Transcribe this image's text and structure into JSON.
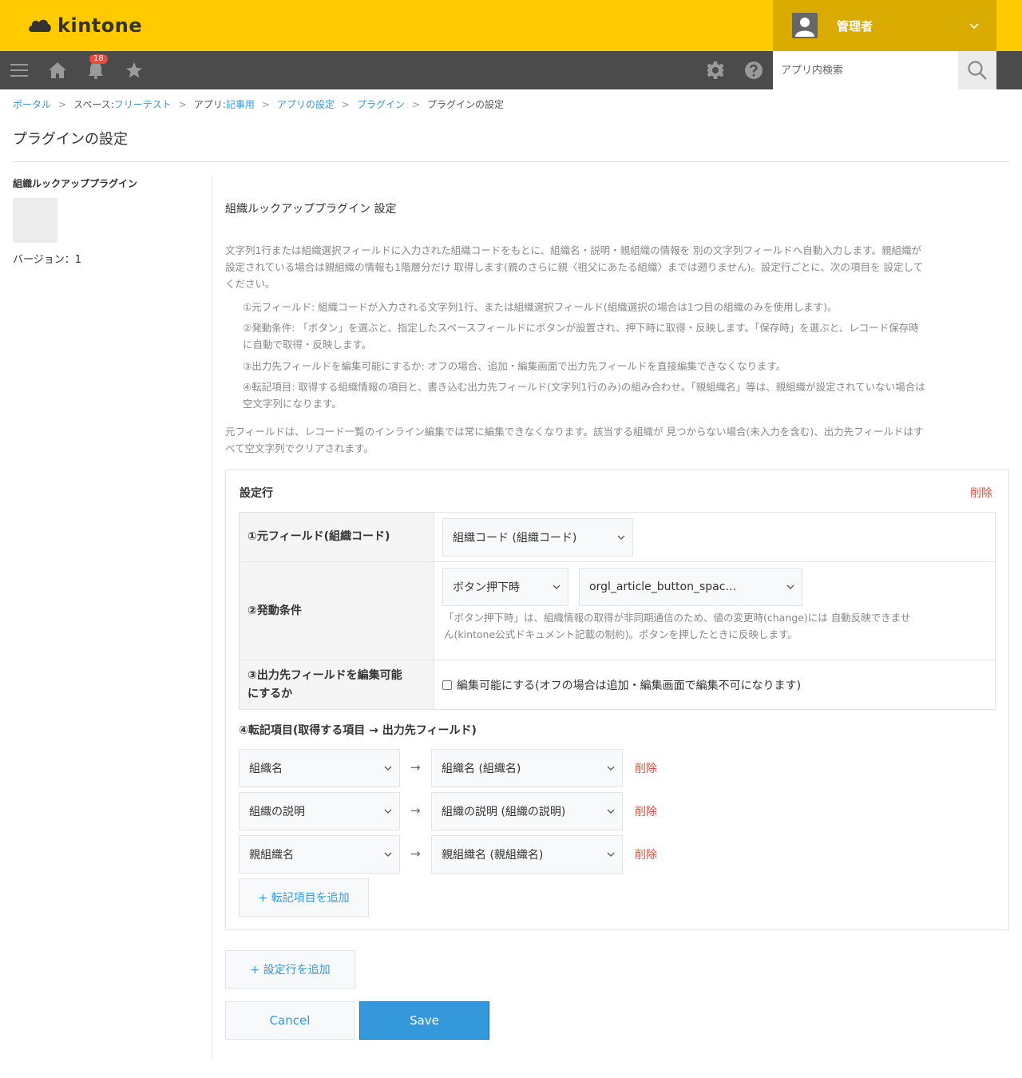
{
  "header": {
    "logo_text": "kintone",
    "user_name": "管理者",
    "brand_color": "#ffcb00",
    "user_area_color": "#d9ab00"
  },
  "navbar": {
    "notification_count": "18",
    "search_placeholder": "アプリ内検索",
    "icons": [
      "menu-icon",
      "home-icon",
      "bell-icon",
      "star-icon",
      "gear-icon",
      "help-icon",
      "search-icon"
    ]
  },
  "breadcrumb": {
    "portal": "ポータル",
    "space_prefix": "スペース: ",
    "space": "フリーテスト",
    "app_prefix": "アプリ: ",
    "app": "記事用",
    "app_settings": "アプリの設定",
    "plugins": "プラグイン",
    "current": "プラグインの設定",
    "separator": ">"
  },
  "page_title": "プラグインの設定",
  "plugin": {
    "name": "組織ルックアッププラグイン",
    "version": "バージョン：1"
  },
  "settings": {
    "title": "組織ルックアッププラグイン 設定",
    "description_lines": [
      "文字列1行または組織選択フィールドに入力された組織コードをもとに、組織名・説明・親組織の情報を 別の文字列フィールドへ自動入力します。親組織が",
      "設定されている場合は親組織の情報も1階層分だけ 取得します(親のさらに親〈祖父にあたる組織〉までは遡りません)。設定行ごとに、次の項目を 設定して",
      "ください。"
    ],
    "items": [
      [
        "①元フィールド: 組織コードが入力される文字列1行、または組織選択フィールド(組織選択の場合は1つ目の組織のみを使用します)。"
      ],
      [
        "②発動条件: 「ボタン」を選ぶと、指定したスペースフィールドにボタンが設置され、押下時に取得・反映します。「保存時」を選ぶと、レコード保存時",
        "に自動で取得・反映します。"
      ],
      [
        "③出力先フィールドを編集可能にするか: オフの場合、追加・編集画面で出力先フィールドを直接編集できなくなります。"
      ],
      [
        "④転記項目: 取得する組織情報の項目と、書き込む出力先フィールド(文字列1行のみ)の組み合わせ。「親組織名」等は、親組織が設定されていない場合は",
        "空文字列になります。"
      ]
    ],
    "footer_lines": [
      "元フィールドは、レコード一覧のインライン編集では常に編集できなくなります。該当する組織が 見つからない場合(未入力を含む)、出力先フィールドはす",
      "べて空文字列でクリアされます。"
    ]
  },
  "config_row": {
    "title": "設定行",
    "delete_label": "削除",
    "source_field_label": "①元フィールド(組織コード)",
    "source_field_value": "組織コード (組織コード)",
    "trigger_label": "②発動条件",
    "trigger_value": "ボタン押下時",
    "space_field_value": "orgl_article_button_spac…",
    "trigger_note_lines": [
      "「ボタン押下時」は、組織情報の取得が非同期通信のため、値の変更時(change)には 自動反映できませ",
      "ん(kintone公式ドキュメント記載の制約)。ボタンを押したときに反映します。"
    ],
    "editable_label_lines": [
      "③出力先フィールドを編集可能",
      "にするか"
    ],
    "editable_checkbox_label": "編集可能にする(オフの場合は追加・編集画面で編集不可になります)",
    "editable_checked": false,
    "mapping_title": "④転記項目(取得する項目 → 出力先フィールド)",
    "mappings": [
      {
        "source": "組織名",
        "target": "組織名 (組織名)",
        "delete": "削除"
      },
      {
        "source": "組織の説明",
        "target": "組織の説明 (組織の説明)",
        "delete": "削除"
      },
      {
        "source": "親組織名",
        "target": "親組織名 (親組織名)",
        "delete": "削除"
      }
    ],
    "arrow": "→",
    "add_mapping_label": "+ 転記項目を追加"
  },
  "actions": {
    "add_row_label": "+ 設定行を追加",
    "cancel_label": "Cancel",
    "save_label": "Save",
    "save_color": "#3498db",
    "delete_color": "#e74c3c"
  }
}
